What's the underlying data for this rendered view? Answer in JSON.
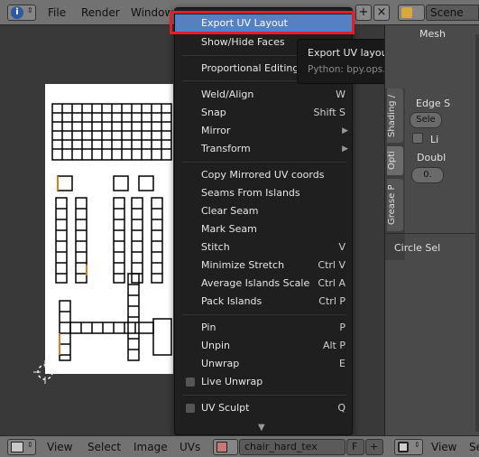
{
  "colors": {
    "menu_bg": "#1f1f1f",
    "highlight": "#5680c2",
    "annotation_box": "#e01f2a",
    "header_bg": "#727272",
    "viewport_bg": "#393939",
    "uv_image_bg": "#ffffff"
  },
  "top_bar": {
    "info_icon": "info-icon",
    "menus": [
      "File",
      "Render",
      "Window"
    ],
    "scene_label": "Scene"
  },
  "uv_menu": {
    "items": [
      {
        "label": "Export UV Layout",
        "shortcut": "",
        "submenu": false,
        "highlighted": true
      },
      {
        "label": "Show/Hide Faces",
        "shortcut": "",
        "submenu": true
      },
      {
        "label": "Proportional Editing",
        "shortcut": "",
        "submenu": true
      },
      {
        "label": "Weld/Align",
        "shortcut": "W",
        "submenu": false
      },
      {
        "label": "Snap",
        "shortcut": "Shift S",
        "submenu": false
      },
      {
        "label": "Mirror",
        "shortcut": "",
        "submenu": true
      },
      {
        "label": "Transform",
        "shortcut": "",
        "submenu": true
      },
      {
        "label": "Copy Mirrored UV coords",
        "shortcut": "",
        "submenu": false
      },
      {
        "label": "Seams From Islands",
        "shortcut": "",
        "submenu": false
      },
      {
        "label": "Clear Seam",
        "shortcut": "",
        "submenu": false
      },
      {
        "label": "Mark Seam",
        "shortcut": "",
        "submenu": false
      },
      {
        "label": "Stitch",
        "shortcut": "V",
        "submenu": false
      },
      {
        "label": "Minimize Stretch",
        "shortcut": "Ctrl V",
        "submenu": false
      },
      {
        "label": "Average Islands Scale",
        "shortcut": "Ctrl A",
        "submenu": false
      },
      {
        "label": "Pack Islands",
        "shortcut": "Ctrl P",
        "submenu": false
      },
      {
        "label": "Pin",
        "shortcut": "P",
        "submenu": false
      },
      {
        "label": "Unpin",
        "shortcut": "Alt P",
        "submenu": false
      },
      {
        "label": "Unwrap",
        "shortcut": "E",
        "submenu": false
      },
      {
        "label": "Live Unwrap",
        "shortcut": "",
        "submenu": false,
        "checkbox": true
      },
      {
        "label": "UV Sculpt",
        "shortcut": "Q",
        "submenu": false,
        "checkbox": true
      }
    ]
  },
  "tooltip": {
    "title": "Export UV layout to file",
    "python": "Python: bpy.ops.uv.export_layout"
  },
  "right_panel": {
    "header": "Mesh",
    "tabs": [
      "Shading /",
      "Opti",
      "Grease P"
    ],
    "edge_label": "Edge S",
    "select_value": "Sele",
    "checkbox_label": "Li",
    "double_label": "Doubl",
    "double_value": "0.",
    "circle_select": "Circle Sel"
  },
  "bottom_bar": {
    "menus": [
      "View",
      "Select",
      "Image",
      "UVs"
    ],
    "image_name": "chair_hard_tex",
    "fake_user": "F",
    "add_icon": "+",
    "right_menus": [
      "View",
      "Se"
    ]
  }
}
